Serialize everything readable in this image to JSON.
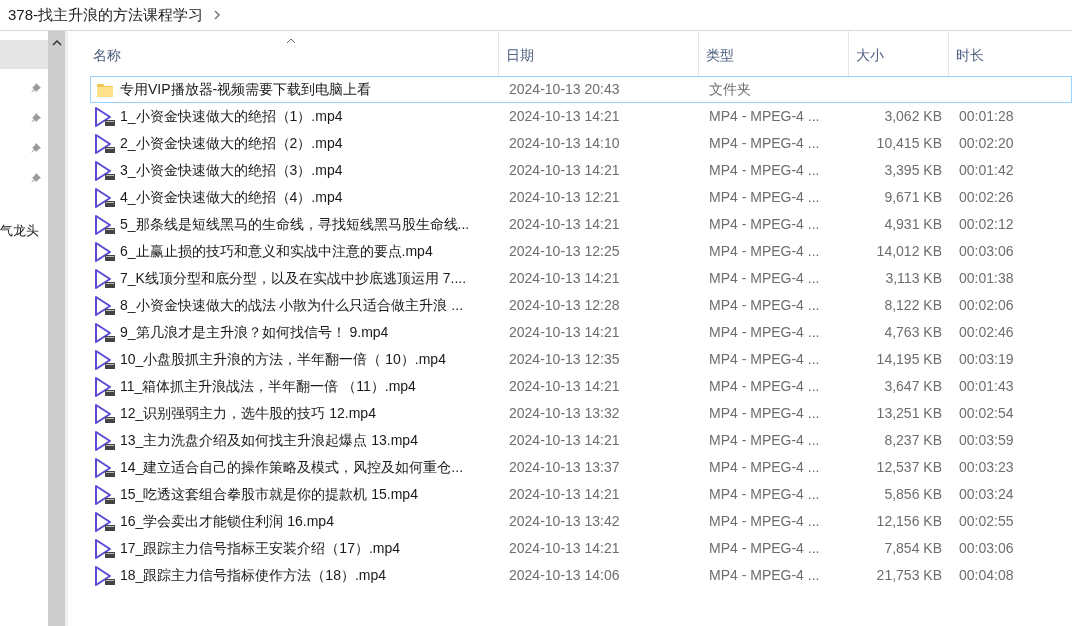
{
  "breadcrumb": {
    "path": "378-找主升浪的方法课程学习"
  },
  "nav_pane": {
    "items": [
      {
        "kind": "highlight"
      },
      {
        "kind": "pin"
      },
      {
        "kind": "pin"
      },
      {
        "kind": "pin"
      },
      {
        "kind": "pin"
      },
      {
        "kind": "text",
        "label": "气龙头"
      }
    ]
  },
  "table": {
    "columns": [
      {
        "label": "名称",
        "sorted": true
      },
      {
        "label": "日期",
        "sorted": false
      },
      {
        "label": "类型",
        "sorted": false
      },
      {
        "label": "大小",
        "sorted": false
      },
      {
        "label": "时长",
        "sorted": false
      }
    ],
    "rows": [
      {
        "kind": "folder",
        "selected": true,
        "name": "专用VIP播放器-视频需要下载到电脑上看",
        "date": "2024-10-13 20:43",
        "type": "文件夹"
      },
      {
        "kind": "video",
        "selected": false,
        "name": "1_小资金快速做大的绝招（1）.mp4",
        "date": "2024-10-13 14:21",
        "type": "MP4 - MPEG-4 ...",
        "size": "3,062 KB",
        "duration": "00:01:28"
      },
      {
        "kind": "video",
        "selected": false,
        "name": "2_小资金快速做大的绝招（2）.mp4",
        "date": "2024-10-13 14:10",
        "type": "MP4 - MPEG-4 ...",
        "size": "10,415 KB",
        "duration": "00:02:20"
      },
      {
        "kind": "video",
        "selected": false,
        "name": "3_小资金快速做大的绝招（3）.mp4",
        "date": "2024-10-13 14:21",
        "type": "MP4 - MPEG-4 ...",
        "size": "3,395 KB",
        "duration": "00:01:42"
      },
      {
        "kind": "video",
        "selected": false,
        "name": "4_小资金快速做大的绝招（4）.mp4",
        "date": "2024-10-13 12:21",
        "type": "MP4 - MPEG-4 ...",
        "size": "9,671 KB",
        "duration": "00:02:26"
      },
      {
        "kind": "video",
        "selected": false,
        "name": "5_那条线是短线黑马的生命线，寻找短线黑马股生命线...",
        "date": "2024-10-13 14:21",
        "type": "MP4 - MPEG-4 ...",
        "size": "4,931 KB",
        "duration": "00:02:12"
      },
      {
        "kind": "video",
        "selected": false,
        "name": "6_止赢止损的技巧和意义和实战中注意的要点.mp4",
        "date": "2024-10-13 12:25",
        "type": "MP4 - MPEG-4 ...",
        "size": "14,012 KB",
        "duration": "00:03:06"
      },
      {
        "kind": "video",
        "selected": false,
        "name": "7_K线顶分型和底分型，以及在实战中抄底逃顶运用 7....",
        "date": "2024-10-13 14:21",
        "type": "MP4 - MPEG-4 ...",
        "size": "3,113 KB",
        "duration": "00:01:38"
      },
      {
        "kind": "video",
        "selected": false,
        "name": "8_小资金快速做大的战法 小散为什么只适合做主升浪 ...",
        "date": "2024-10-13 12:28",
        "type": "MP4 - MPEG-4 ...",
        "size": "8,122 KB",
        "duration": "00:02:06"
      },
      {
        "kind": "video",
        "selected": false,
        "name": "9_第几浪才是主升浪？如何找信号！ 9.mp4",
        "date": "2024-10-13 14:21",
        "type": "MP4 - MPEG-4 ...",
        "size": "4,763 KB",
        "duration": "00:02:46"
      },
      {
        "kind": "video",
        "selected": false,
        "name": "10_小盘股抓主升浪的方法，半年翻一倍（ 10）.mp4",
        "date": "2024-10-13 12:35",
        "type": "MP4 - MPEG-4 ...",
        "size": "14,195 KB",
        "duration": "00:03:19"
      },
      {
        "kind": "video",
        "selected": false,
        "name": "11_箱体抓主升浪战法，半年翻一倍 （11）.mp4",
        "date": "2024-10-13 14:21",
        "type": "MP4 - MPEG-4 ...",
        "size": "3,647 KB",
        "duration": "00:01:43"
      },
      {
        "kind": "video",
        "selected": false,
        "name": "12_识别强弱主力，选牛股的技巧 12.mp4",
        "date": "2024-10-13 13:32",
        "type": "MP4 - MPEG-4 ...",
        "size": "13,251 KB",
        "duration": "00:02:54"
      },
      {
        "kind": "video",
        "selected": false,
        "name": "13_主力洗盘介绍及如何找主升浪起爆点 13.mp4",
        "date": "2024-10-13 14:21",
        "type": "MP4 - MPEG-4 ...",
        "size": "8,237 KB",
        "duration": "00:03:59"
      },
      {
        "kind": "video",
        "selected": false,
        "name": "14_建立适合自己的操作策略及模式，风控及如何重仓...",
        "date": "2024-10-13 13:37",
        "type": "MP4 - MPEG-4 ...",
        "size": "12,537 KB",
        "duration": "00:03:23"
      },
      {
        "kind": "video",
        "selected": false,
        "name": "15_吃透这套组合拳股市就是你的提款机 15.mp4",
        "date": "2024-10-13 14:21",
        "type": "MP4 - MPEG-4 ...",
        "size": "5,856 KB",
        "duration": "00:03:24"
      },
      {
        "kind": "video",
        "selected": false,
        "name": "16_学会卖出才能锁住利润 16.mp4",
        "date": "2024-10-13 13:42",
        "type": "MP4 - MPEG-4 ...",
        "size": "12,156 KB",
        "duration": "00:02:55"
      },
      {
        "kind": "video",
        "selected": false,
        "name": "17_跟踪主力信号指标王安装介绍（17）.mp4",
        "date": "2024-10-13 14:21",
        "type": "MP4 - MPEG-4 ...",
        "size": "7,854 KB",
        "duration": "00:03:06"
      },
      {
        "kind": "video",
        "selected": false,
        "name": "18_跟踪主力信号指标使作方法（18）.mp4",
        "date": "2024-10-13 14:06",
        "type": "MP4 - MPEG-4 ...",
        "size": "21,753 KB",
        "duration": "00:04:08"
      }
    ]
  }
}
